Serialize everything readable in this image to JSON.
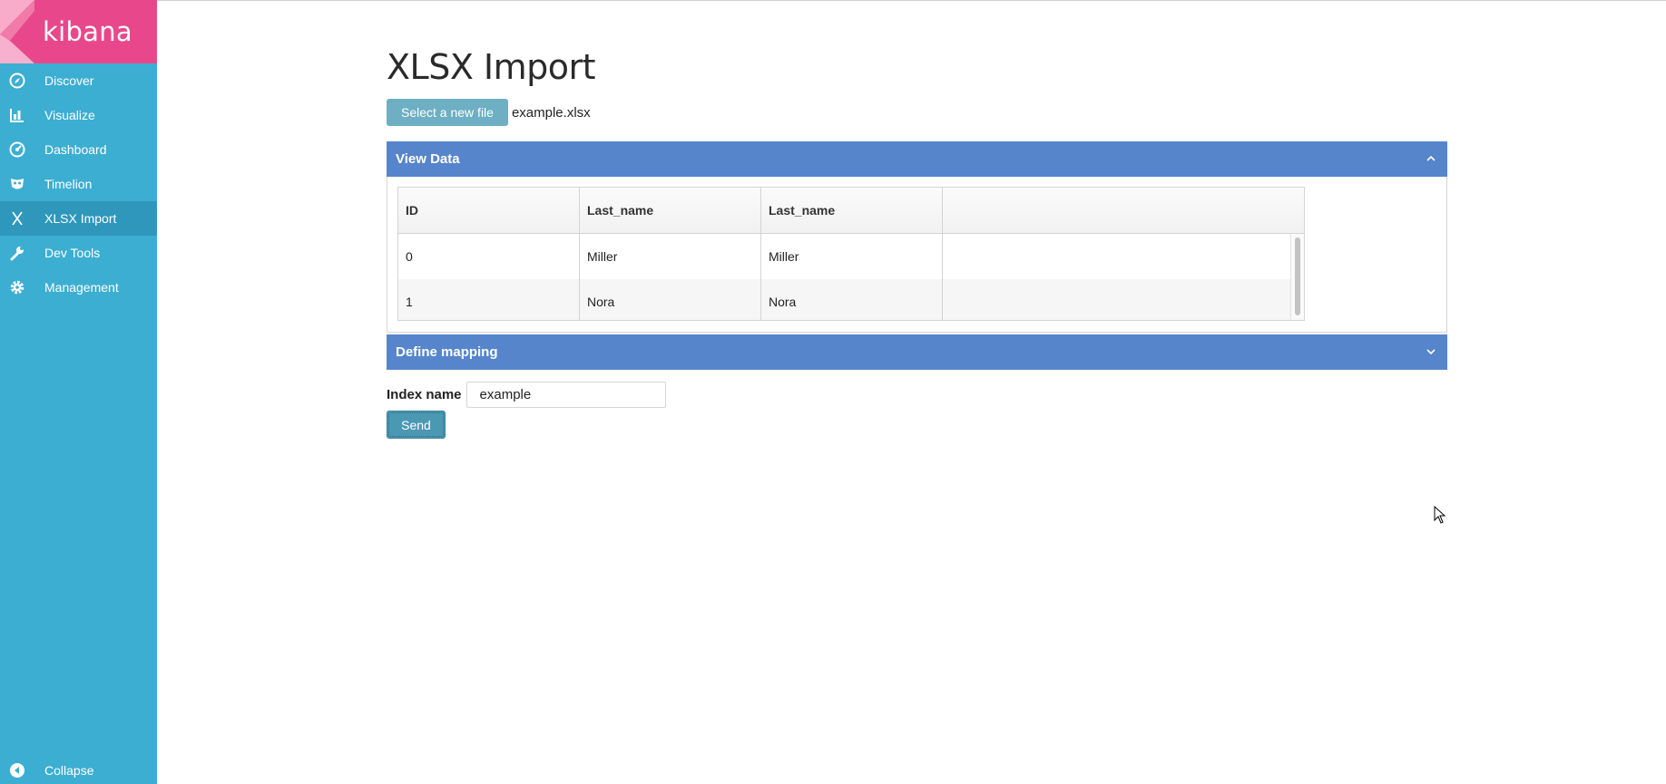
{
  "app": {
    "brand": "kibana"
  },
  "sidebar": {
    "items": [
      {
        "label": "Discover",
        "icon": "compass-icon",
        "active": false
      },
      {
        "label": "Visualize",
        "icon": "bar-chart-icon",
        "active": false
      },
      {
        "label": "Dashboard",
        "icon": "dashboard-gauge-icon",
        "active": false
      },
      {
        "label": "Timelion",
        "icon": "timelion-mask-icon",
        "active": false
      },
      {
        "label": "XLSX Import",
        "icon": "x-icon",
        "active": true
      },
      {
        "label": "Dev Tools",
        "icon": "wrench-icon",
        "active": false
      },
      {
        "label": "Management",
        "icon": "gear-icon",
        "active": false
      }
    ],
    "collapse_label": "Collapse"
  },
  "main": {
    "title": "XLSX Import",
    "select_file_label": "Select a new file",
    "file_name": "example.xlsx",
    "view_data": {
      "title": "View Data",
      "expanded": true,
      "columns": [
        "ID",
        "Last_name",
        "Last_name",
        ""
      ],
      "rows": [
        [
          "0",
          "Miller",
          "Miller",
          ""
        ],
        [
          "1",
          "Nora",
          "Nora",
          ""
        ]
      ]
    },
    "define_mapping": {
      "title": "Define mapping",
      "expanded": false
    },
    "index_name_label": "Index name",
    "index_name_value": "example",
    "send_label": "Send"
  },
  "colors": {
    "sidebar_bg": "#3caed2",
    "sidebar_active": "#2f97bb",
    "logo_bg": "#e8488b",
    "panel_header": "#5785cc",
    "select_button": "#6eafc3",
    "send_button": "#4b98b3"
  }
}
